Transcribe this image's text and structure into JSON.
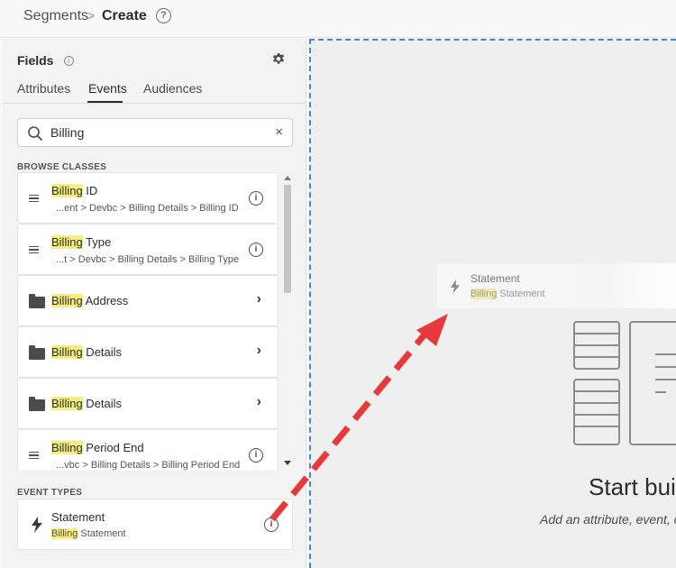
{
  "breadcrumb": {
    "parent": "Segments",
    "separator": ">",
    "current": "Create",
    "help_symbol": "?"
  },
  "fields_panel": {
    "title": "Fields",
    "info_symbol": "i",
    "settings_icon": "gear-icon",
    "tabs": [
      {
        "label": "Attributes",
        "active": false
      },
      {
        "label": "Events",
        "active": true
      },
      {
        "label": "Audiences",
        "active": false
      }
    ],
    "search": {
      "value": "Billing",
      "icon": "search-icon",
      "clear_symbol": "×"
    },
    "browse_classes_label": "BROWSE CLASSES",
    "items": [
      {
        "kind": "field",
        "icon": "drag-handle-icon",
        "highlight": "Billing",
        "rest": " ID",
        "path": "...ent > Devbc > Billing Details > Billing ID"
      },
      {
        "kind": "field",
        "icon": "drag-handle-icon",
        "highlight": "Billing",
        "rest": " Type",
        "path": "...t > Devbc > Billing Details > Billing Type"
      },
      {
        "kind": "folder",
        "icon": "folder-icon",
        "highlight": "Billing",
        "rest": " Address"
      },
      {
        "kind": "folder",
        "icon": "folder-icon",
        "highlight": "Billing",
        "rest": " Details"
      },
      {
        "kind": "folder",
        "icon": "folder-icon",
        "highlight": "Billing",
        "rest": " Details"
      },
      {
        "kind": "field",
        "icon": "drag-handle-icon",
        "highlight": "Billing",
        "rest": " Period End",
        "path": "...vbc > Billing Details > Billing Period End"
      }
    ],
    "info_symbol_item": "i",
    "chevron_symbol": "›",
    "event_types_label": "EVENT TYPES",
    "event": {
      "icon": "bolt-icon",
      "title": "Statement",
      "sub_highlight": "Billing",
      "sub_rest": " Statement"
    }
  },
  "canvas": {
    "drag_ghost": {
      "icon": "bolt-icon",
      "title": "Statement",
      "sub_highlight": "Billing",
      "sub_rest": " Statement"
    },
    "start_title": "Start buil",
    "start_subtitle": "Add an attribute, event, c"
  },
  "colors": {
    "highlight": "#f6ee80",
    "drop_border": "#3e86d6",
    "arrow": "#e8393a"
  }
}
